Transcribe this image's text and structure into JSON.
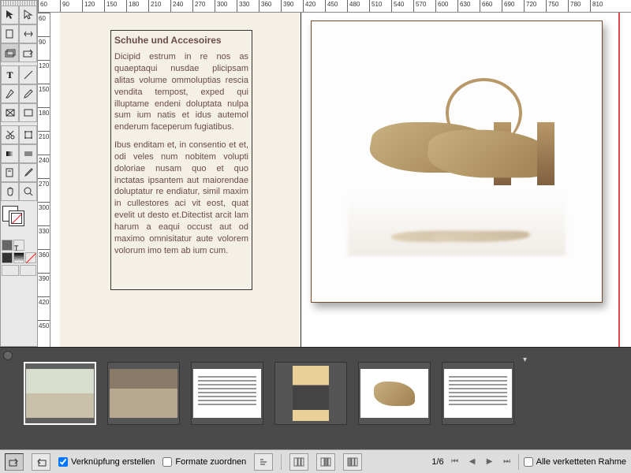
{
  "ruler_h": [
    60,
    90,
    120,
    150,
    180,
    210,
    240,
    270,
    300,
    330,
    360,
    390,
    420,
    450,
    480,
    510,
    540,
    570,
    600,
    630,
    660,
    690,
    720,
    750,
    780,
    810
  ],
  "ruler_v": [
    60,
    90,
    120,
    150,
    180,
    210,
    240,
    270,
    300,
    330,
    360,
    390,
    420,
    450
  ],
  "textframe": {
    "heading": "Schuhe und Accesoires",
    "para1": "Dicipid estrum in re nos as quaeptaqui nusdae plicipsam alitas volume ommoluptias rescia vendita tempost, exped qui illuptame endeni doluptata nulpa sum ium natis et idus autemol enderum faceperum fugiatibus.",
    "para2": "Ibus enditam et, in consentio et et, odi veles num nobitem volupti doloriae nusam quo et quo inctatas ipsantem aut maiorendae doluptatur re endiatur, simil maxim in cullestores aci vit eost, quat evelit ut desto et.Ditectist arcit lam harum a eaqui occust aut od maximo omnisitatur aute volorem volorum imo tem ab ium cum."
  },
  "panel": {
    "link_checkbox": "Verknüpfung erstellen",
    "formats_checkbox": "Formate zuordnen",
    "chained_checkbox": "Alle verketteten Rahme",
    "page_indicator": "1/6",
    "link_checked": true,
    "formats_checked": false,
    "chained_checked": false
  }
}
